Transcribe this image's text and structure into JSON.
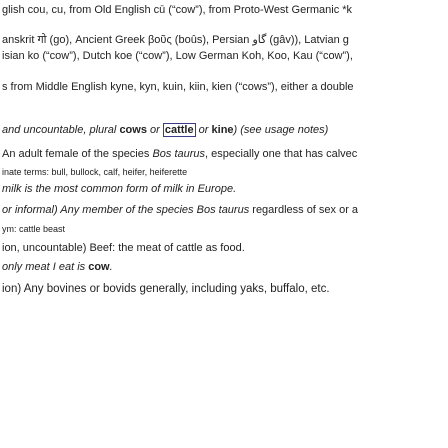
{
  "etymology": {
    "line1": "glish cou, cu, from Old English cū (“cow”), from Proto-West Germanic *k",
    "line2": "anskrit गो (go), Ancient Greek βοῦς (boûs), Persian گاو (gâv)), Latvian g",
    "line3": "isian ko (“cow”), Dutch koe (“cow”), Low German Koh, Koo, Kau (“cow”),",
    "line4": "s from Middle English kyne, kyn, kuin, kiin, kien (“cows”), either a double"
  },
  "plural": {
    "pre": "and uncountable, plural ",
    "cows": "cows",
    "or1": " or ",
    "cattle": "cattle",
    "or2": " or ",
    "kine": "kine",
    "post": ") (see usage notes)"
  },
  "definitions": {
    "def1": {
      "pre": "An adult female of the species ",
      "species": "Bos taurus",
      "post": ", especially one that has calvec"
    },
    "def1_syn": {
      "label": "inate terms: ",
      "terms": "bull, bullock, calf, heifer, heiferette"
    },
    "def1_note": "milk is the most common form of milk in Europe.",
    "def2": {
      "pre": "or informal) Any member of the species ",
      "species": "Bos taurus",
      "post": " regardless of sex or a"
    },
    "def2_syn": {
      "label": "ym: ",
      "terms": "cattle beast"
    },
    "def3": "ion, uncountable) Beef: the meat of cattle as food.",
    "def3_note": {
      "pre": "only meat I eat is ",
      "word": "cow",
      "post": "."
    },
    "def4": "ion) Any bovines or bovids generally, including yaks, buffalo, etc."
  }
}
